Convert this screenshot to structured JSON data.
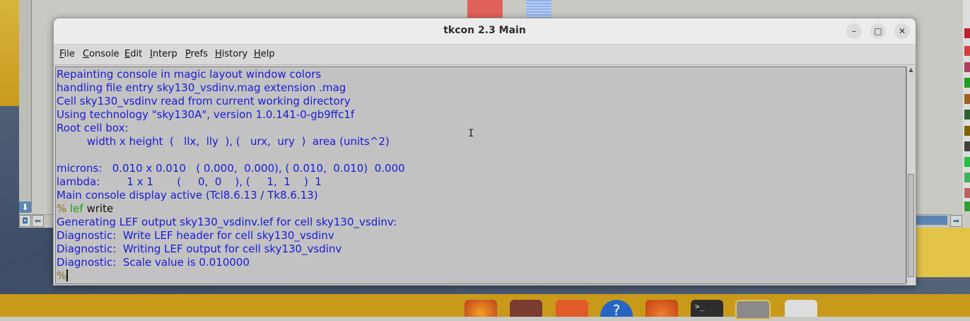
{
  "window": {
    "title": "tkcon 2.3 Main",
    "controls": {
      "minimize": "–",
      "maximize": "□",
      "close": "✕"
    }
  },
  "menu": [
    {
      "label": "File",
      "accel": "F",
      "rest": "ile"
    },
    {
      "label": "Console",
      "accel": "C",
      "rest": "onsole"
    },
    {
      "label": "Edit",
      "accel": "E",
      "rest": "dit"
    },
    {
      "label": "Interp",
      "accel": "I",
      "rest": "nterp"
    },
    {
      "label": "Prefs",
      "accel": "P",
      "rest": "refs"
    },
    {
      "label": "History",
      "accel": "H",
      "rest": "istory"
    },
    {
      "label": "Help",
      "accel": "H",
      "rest": "elp"
    }
  ],
  "console": {
    "lines": [
      "Repainting console in magic layout window colors",
      "handling file entry sky130_vsdinv.mag extension .mag",
      "Cell sky130_vsdinv read from current working directory",
      "Using technology \"sky130A\", version 1.0.141-0-gb9ffc1f",
      "Root cell box:",
      "         width x height  (   llx,  lly  ), (   urx,  ury  )  area (units^2)",
      "",
      "microns:   0.010 x 0.010   ( 0.000,  0.000), ( 0.010,  0.010)  0.000",
      "lambda:        1 x 1       (     0,  0    ), (     1,  1    )  1",
      "Main console display active (Tcl8.6.13 / Tk8.6.13)"
    ],
    "prompt_symbol": "%",
    "command_keyword": "lef",
    "command_arg": "write",
    "output_lines": [
      "Generating LEF output sky130_vsdinv.lef for cell sky130_vsdinv:",
      "Diagnostic:  Write LEF header for cell sky130_vsdinv",
      "Diagnostic:  Writing LEF output for cell sky130_vsdinv",
      "Diagnostic:  Scale value is 0.010000"
    ],
    "final_prompt": "%"
  },
  "background": {
    "scroll_arrows": {
      "down": "⬇",
      "left": "⬅",
      "right": "➡",
      "home": "◘"
    }
  },
  "taskbar": {
    "icons": [
      "firefox-icon",
      "files-icon",
      "software-store-icon",
      "help-icon",
      "settings-app-icon",
      "terminal-icon",
      "system-settings-icon",
      "trash-icon"
    ],
    "terminal_glyph": ">_"
  },
  "colors": {
    "console_text": "#1a1ad8",
    "prompt": "#8a6d1a",
    "command": "#16a016",
    "console_bg": "#c2c2c2",
    "taskbar": "#c99a1a"
  }
}
